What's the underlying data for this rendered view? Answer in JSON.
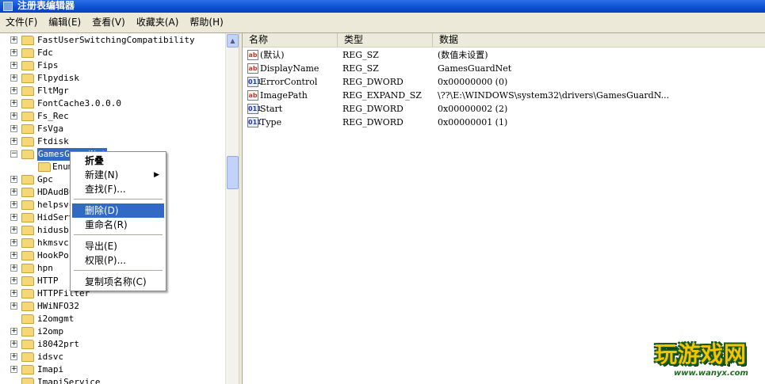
{
  "window": {
    "title": "注册表编辑器"
  },
  "menu": [
    "文件(F)",
    "编辑(E)",
    "查看(V)",
    "收藏夹(A)",
    "帮助(H)"
  ],
  "tree": {
    "items": [
      {
        "label": "FastUserSwitchingCompatibility",
        "expander": "+"
      },
      {
        "label": "Fdc",
        "expander": "+"
      },
      {
        "label": "Fips",
        "expander": "+"
      },
      {
        "label": "Flpydisk",
        "expander": "+"
      },
      {
        "label": "FltMgr",
        "expander": "+"
      },
      {
        "label": "FontCache3.0.0.0",
        "expander": "+"
      },
      {
        "label": "Fs_Rec",
        "expander": "+"
      },
      {
        "label": "FsVga",
        "expander": "+"
      },
      {
        "label": "Ftdisk",
        "expander": "+"
      },
      {
        "label": "GamesGuardNet",
        "expander": "-",
        "selected": true
      },
      {
        "label": "Enum",
        "expander": "",
        "child": true
      },
      {
        "label": "Gpc",
        "expander": "+"
      },
      {
        "label": "HDAudBus",
        "expander": "+"
      },
      {
        "label": "helpsvc",
        "expander": "+"
      },
      {
        "label": "HidServ",
        "expander": "+"
      },
      {
        "label": "hidusb",
        "expander": "+"
      },
      {
        "label": "hkmsvc",
        "expander": "+"
      },
      {
        "label": "HookPort",
        "expander": "+"
      },
      {
        "label": "hpn",
        "expander": "+"
      },
      {
        "label": "HTTP",
        "expander": "+"
      },
      {
        "label": "HTTPFilter",
        "expander": "+"
      },
      {
        "label": "HWiNFO32",
        "expander": "+"
      },
      {
        "label": "i2omgmt",
        "expander": ""
      },
      {
        "label": "i2omp",
        "expander": "+"
      },
      {
        "label": "i8042prt",
        "expander": "+"
      },
      {
        "label": "idsvc",
        "expander": "+"
      },
      {
        "label": "Imapi",
        "expander": "+"
      },
      {
        "label": "ImapiService",
        "expander": ""
      }
    ]
  },
  "list": {
    "headers": {
      "name": "名称",
      "type": "类型",
      "data": "数据"
    },
    "rows": [
      {
        "icon": "ab",
        "name": "(默认)",
        "type": "REG_SZ",
        "data": "(数值未设置)"
      },
      {
        "icon": "ab",
        "name": "DisplayName",
        "type": "REG_SZ",
        "data": "GamesGuardNet"
      },
      {
        "icon": "dword",
        "name": "ErrorControl",
        "type": "REG_DWORD",
        "data": "0x00000000 (0)"
      },
      {
        "icon": "ab",
        "name": "ImagePath",
        "type": "REG_EXPAND_SZ",
        "data": "\\??\\E:\\WINDOWS\\system32\\drivers\\GamesGuardN..."
      },
      {
        "icon": "dword",
        "name": "Start",
        "type": "REG_DWORD",
        "data": "0x00000002 (2)"
      },
      {
        "icon": "dword",
        "name": "Type",
        "type": "REG_DWORD",
        "data": "0x00000001 (1)"
      }
    ]
  },
  "context_menu": {
    "collapse": "折叠",
    "new": "新建(N)",
    "find": "查找(F)...",
    "delete": "删除(D)",
    "rename": "重命名(R)",
    "export": "导出(E)",
    "permissions": "权限(P)...",
    "copy_key_name": "复制项名称(C)",
    "highlighted": "delete"
  },
  "watermark": {
    "text": "玩游戏网",
    "url": "www.wanyx.com"
  },
  "colors": {
    "title_bar": "#0a4fd1",
    "selection": "#316ac5",
    "menu_bg": "#ece9d8",
    "watermark_yellow": "#f5c400",
    "watermark_green": "#1a5a1a"
  }
}
